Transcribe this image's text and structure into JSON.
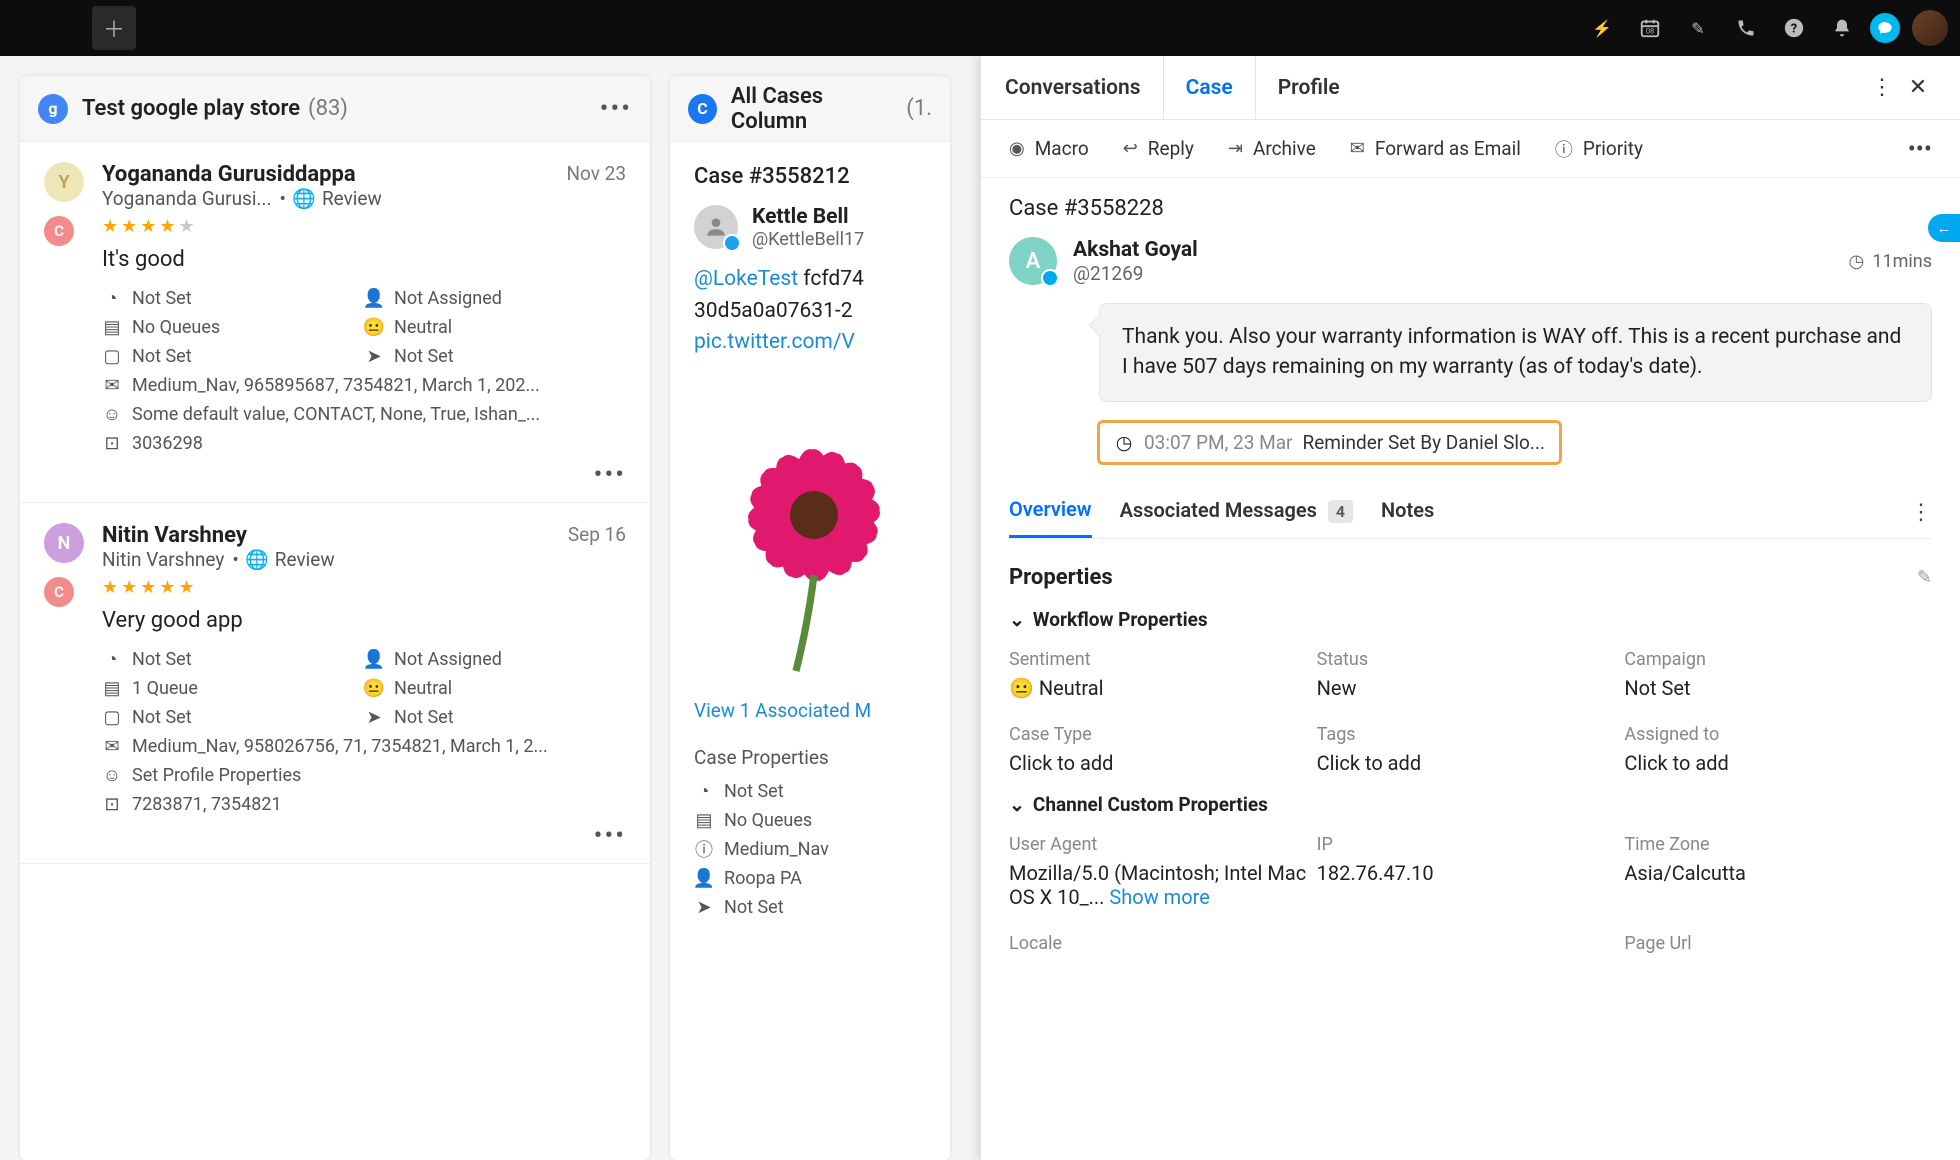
{
  "topbar": {
    "icons": [
      "bolt",
      "calendar",
      "edit",
      "phone",
      "help",
      "bell",
      "chat",
      "avatar"
    ]
  },
  "columns": [
    {
      "icon_bg": "#4285f4",
      "icon_text": "g",
      "title": "Test google play store",
      "count": "(83)",
      "cards": [
        {
          "avatar_bg": "#efe6b8",
          "avatar_letter": "Y",
          "name": "Yogananda Gurusiddappa",
          "time": "Nov 23",
          "sub_name": "Yogananda Gurusi...",
          "sub_type": "Review",
          "stars": 4,
          "body": "It's good",
          "meta": {
            "a": "Not Set",
            "b": "Not Assigned",
            "c": "No Queues",
            "d": "Neutral",
            "e": "Not Set",
            "f": "Not Set"
          },
          "lines": [
            "Medium_Nav, 965895687, 7354821, March 1, 202...",
            "Some default value, CONTACT, None, True, Ishan_...",
            "3036298"
          ]
        },
        {
          "avatar_bg": "#c9a0dc",
          "avatar_letter": "N",
          "name": "Nitin Varshney",
          "time": "Sep 16",
          "sub_name": "Nitin Varshney",
          "sub_type": "Review",
          "stars": 5,
          "body": "Very good app",
          "meta": {
            "a": "Not Set",
            "b": "Not Assigned",
            "c": "1 Queue",
            "d": "Neutral",
            "e": "Not Set",
            "f": "Not Set"
          },
          "lines": [
            "Medium_Nav, 958026756, 71, 7354821, March 1, 2...",
            "Set Profile Properties",
            "7283871, 7354821"
          ]
        }
      ]
    },
    {
      "icon_bg": "#1a77f2",
      "icon_text": "C",
      "title": "All Cases Column",
      "count": "(1.",
      "case": {
        "id": "Case #3558212",
        "user": "Kettle Bell",
        "handle": "@KettleBell17",
        "tweet_mention": "@LokeTest",
        "tweet_rest": " fcfd74",
        "tweet_line2": "30d5a0a07631-2",
        "tweet_link": "pic.twitter.com/V",
        "assoc": "View 1 Associated M",
        "props_label": "Case Properties",
        "props": [
          "Not Set",
          "No Queues",
          "Medium_Nav",
          "Roopa PA",
          "Not Set"
        ]
      }
    }
  ],
  "panel": {
    "tabs": [
      "Conversations",
      "Case",
      "Profile"
    ],
    "active_tab": 1,
    "actions": {
      "macro": "Macro",
      "reply": "Reply",
      "archive": "Archive",
      "forward": "Forward as Email",
      "priority": "Priority"
    },
    "case_id": "Case #3558228",
    "message": {
      "avatar_letter": "A",
      "name": "Akshat Goyal",
      "handle": "@21269",
      "time": "11mins",
      "body": "Thank you. Also your warranty information is WAY off. This is a recent purchase and I have 507 days remaining on my warranty (as of today's date)."
    },
    "reminder": {
      "time": "03:07 PM, 23 Mar",
      "text": "Reminder Set By Daniel Slo..."
    },
    "sub_tabs": {
      "overview": "Overview",
      "assoc": "Associated Messages",
      "assoc_count": "4",
      "notes": "Notes"
    },
    "properties_title": "Properties",
    "workflow_title": "Workflow Properties",
    "workflow": {
      "sentiment_label": "Sentiment",
      "sentiment": "Neutral",
      "status_label": "Status",
      "status": "New",
      "campaign_label": "Campaign",
      "campaign": "Not Set",
      "casetype_label": "Case Type",
      "casetype": "Click to add",
      "tags_label": "Tags",
      "tags": "Click to add",
      "assigned_label": "Assigned to",
      "assigned": "Click to add"
    },
    "channel_title": "Channel Custom Properties",
    "channel": {
      "ua_label": "User Agent",
      "ua": "Mozilla/5.0 (Macintosh; Intel Mac OS X 10_... ",
      "show_more": "Show more",
      "ip_label": "IP",
      "ip": "182.76.47.10",
      "tz_label": "Time Zone",
      "tz": "Asia/Calcutta",
      "locale_label": "Locale",
      "pageurl_label": "Page Url"
    }
  }
}
